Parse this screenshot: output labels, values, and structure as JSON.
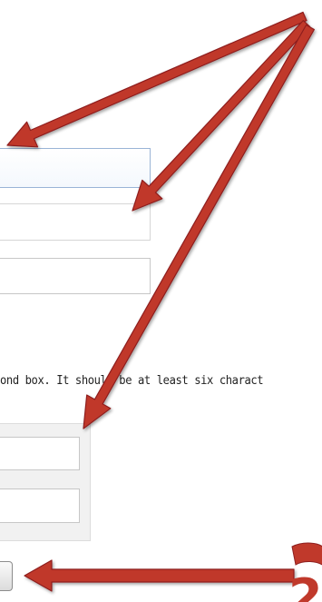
{
  "form": {
    "text_fields": [
      {
        "value": "",
        "placeholder": ""
      },
      {
        "value": "",
        "placeholder": ""
      },
      {
        "value": "",
        "placeholder": ""
      }
    ],
    "password_hint": "ond box. It should be at least six charact",
    "password_fields": [
      {
        "value": ""
      },
      {
        "value": ""
      }
    ],
    "submit_label": ""
  },
  "annotations": {
    "arrow_color": "#c0392b",
    "arrow_outline_color": "#8e1f1f",
    "callout_glyph": "2"
  }
}
